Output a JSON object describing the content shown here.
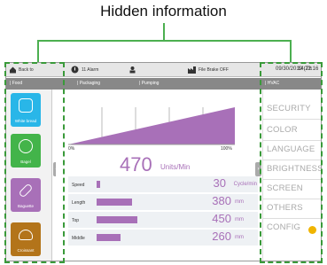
{
  "annotation": {
    "title": "Hidden information"
  },
  "topbar": {
    "back_label": "Back to",
    "alarm_label": "11 Alarm",
    "brake_label": "File Brake OFF",
    "datetime": "09/30/2019 (Th",
    "time": "14:22:16"
  },
  "tabs": [
    "Food",
    "Packaging",
    "Pumping",
    "",
    "HVAC"
  ],
  "products": [
    {
      "label": "White bread",
      "color": "#29b6e8"
    },
    {
      "label": "Bagel",
      "color": "#43b44a"
    },
    {
      "label": "Baguette",
      "color": "#a870b8"
    },
    {
      "label": "Croissant",
      "color": "#b3741a"
    }
  ],
  "gauge": {
    "min_label": "0%",
    "max_label": "100%",
    "value": "470",
    "unit": "Units/Min"
  },
  "metrics": [
    {
      "label": "Speed",
      "value": "30",
      "unit": "Cycle/min",
      "fill": 0.04
    },
    {
      "label": "Length",
      "value": "380",
      "unit": "mm",
      "fill": 0.42
    },
    {
      "label": "Top",
      "value": "450",
      "unit": "mm",
      "fill": 0.48
    },
    {
      "label": "Middle",
      "value": "260",
      "unit": "mm",
      "fill": 0.28
    }
  ],
  "menu": [
    "SECURITY",
    "COLOR",
    "LANGUAGE",
    "BRIGHTNESS",
    "SCREEN",
    "OTHERS",
    "CONFIG"
  ],
  "colors": {
    "accent": "#a870b8",
    "annotation": "#3a9a3a"
  }
}
